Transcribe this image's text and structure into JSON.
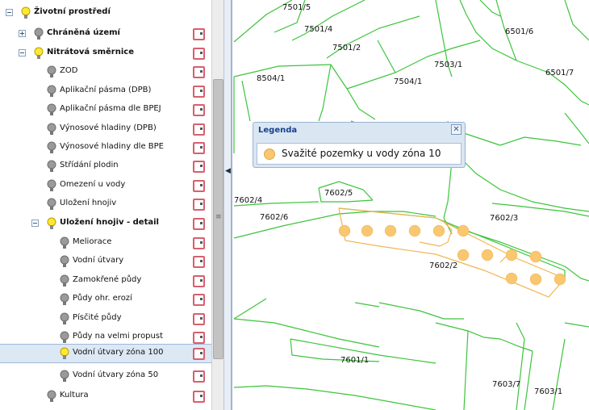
{
  "tree": {
    "root": {
      "label": "Životní prostředí"
    },
    "items": [
      {
        "label": "Chráněná území"
      },
      {
        "label": "Nitrátová směrnice"
      },
      {
        "label": "ZOD"
      },
      {
        "label": "Aplikační pásma (DPB)"
      },
      {
        "label": "Aplikační pásma dle BPEJ"
      },
      {
        "label": "Výnosové hladiny (DPB)"
      },
      {
        "label": "Výnosové hladiny dle BPE"
      },
      {
        "label": "Střídání plodin"
      },
      {
        "label": "Omezení u vody"
      },
      {
        "label": "Uložení hnojiv"
      },
      {
        "label": "Uložení hnojiv - detail"
      },
      {
        "label": "Meliorace"
      },
      {
        "label": "Vodní útvary"
      },
      {
        "label": "Zamokřené půdy"
      },
      {
        "label": "Půdy ohr. erozí"
      },
      {
        "label": "Písčité půdy"
      },
      {
        "label": "Půdy na velmi propust"
      },
      {
        "label": "Vodní útvary zóna 100"
      },
      {
        "label": "Vodní útvary zóna 50"
      },
      {
        "label": "Kultura"
      }
    ]
  },
  "map": {
    "parcels": [
      "7501/5",
      "7501/4",
      "7501/2",
      "7503/1",
      "6501/6",
      "6501/7",
      "8504/1",
      "7504/1",
      "7602/5",
      "7602/4",
      "7602/6",
      "7602/3",
      "7602/2",
      "7601/1",
      "7603/7",
      "7603/1"
    ],
    "line_color": "#3cc43c",
    "zone_color": "#f8c770"
  },
  "legend": {
    "title": "Legenda",
    "item": "Svažité pozemky u vody zóna 10"
  }
}
